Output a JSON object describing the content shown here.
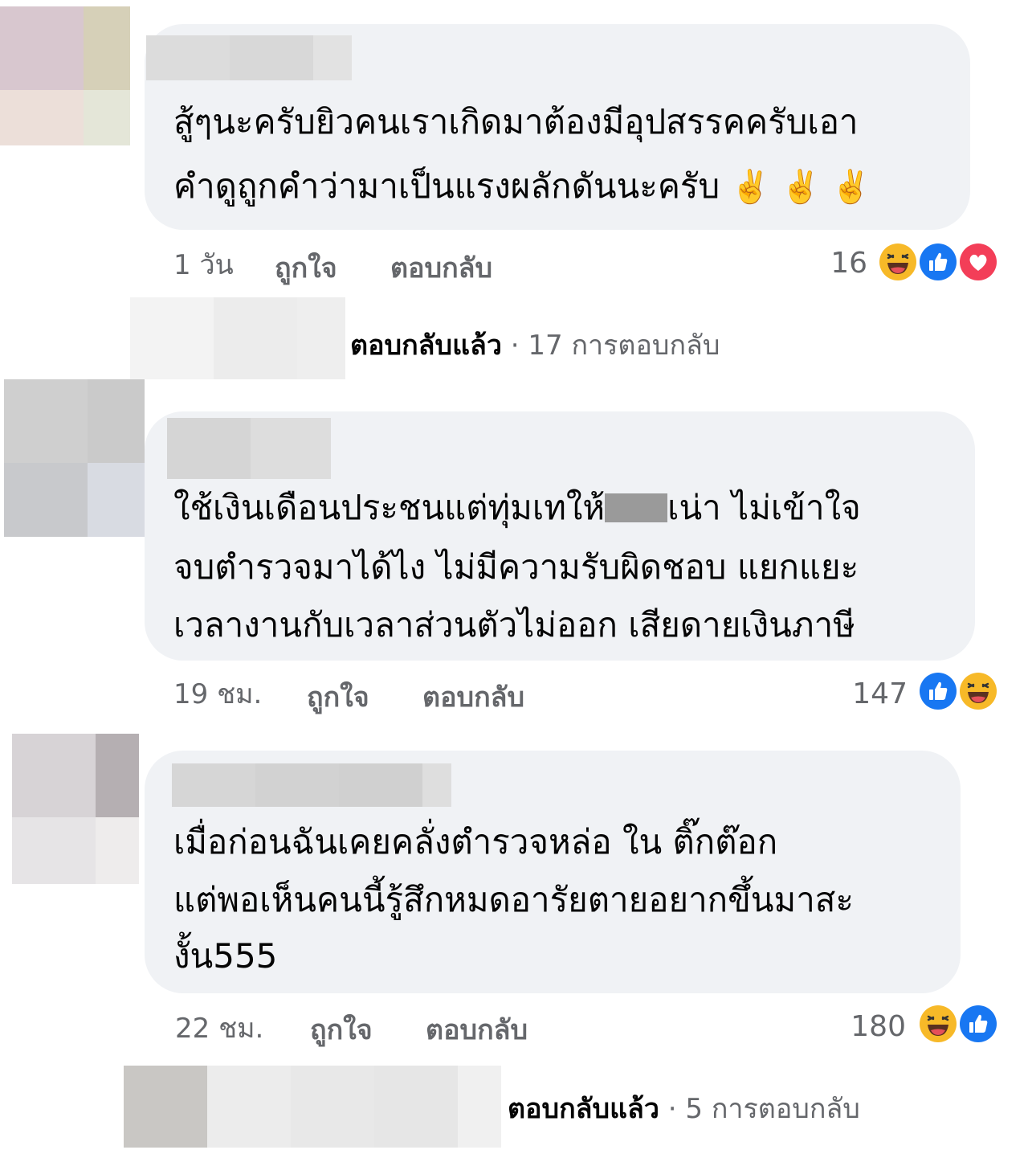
{
  "comments": [
    {
      "text_lines": [
        "สู้ๆนะครับยิวคนเราเกิดมาต้องมีอุปสรรคครับเอา",
        "คำดูถูกคำว่ามาเป็นแรงผลักดันนะครับ"
      ],
      "emoji_trail": "✌️ ✌️ ✌️",
      "time": "1 วัน",
      "like_label": "ถูกใจ",
      "reply_label": "ตอบกลับ",
      "reaction_count": "16",
      "reactions": [
        "haha-icon",
        "like-icon",
        "love-icon"
      ]
    },
    {
      "text_lines": [
        "ใช้เงินเดือนประชนแต่ทุ่มเทให้",
        "เน่า  ไม่เข้าใจ",
        "จบตำรวจมาได้ไง ไม่มีความรับผิดชอบ แยกแยะ",
        "เวลางานกับเวลาส่วนตัวไม่ออก เสียดายเงินภาษี"
      ],
      "time": "19 ชม.",
      "like_label": "ถูกใจ",
      "reply_label": "ตอบกลับ",
      "reaction_count": "147",
      "reactions": [
        "like-icon",
        "haha-icon"
      ]
    },
    {
      "text_lines": [
        "เมื่อก่อนฉันเคยคลั่งตำรวจหล่อ ใน ติ๊กต๊อก",
        "แต่พอเห็นคนนี้รู้สึกหมดอารัยตายอยากขึ้นมาสะ",
        "งั้น555"
      ],
      "time": "22 ชม.",
      "like_label": "ถูกใจ",
      "reply_label": "ตอบกลับ",
      "reaction_count": "180",
      "reactions": [
        "haha-icon",
        "like-icon"
      ]
    }
  ],
  "reply_summaries": [
    {
      "replied": "ตอบกลับแล้ว",
      "separator": "·",
      "count_text": "17 การตอบกลับ"
    },
    {
      "replied": "ตอบกลับแล้ว",
      "separator": "·",
      "count_text": "5 การตอบกลับ"
    }
  ],
  "colors": {
    "bubble": "#f0f2f5",
    "meta_text": "#65676b",
    "like_blue": "#1877f2",
    "love_red": "#f33e58",
    "haha_yellow": "#f7b928"
  }
}
